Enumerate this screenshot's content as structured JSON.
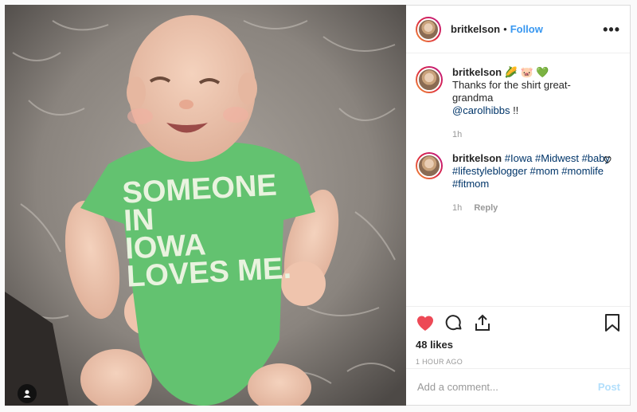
{
  "post": {
    "username": "britkelson",
    "follow_label": "Follow",
    "dot": "•",
    "more_label": "•••"
  },
  "photo": {
    "shirt_text_lines": [
      "SOMEONE",
      "IN",
      "IOWA",
      "LOVES ME."
    ]
  },
  "comments": [
    {
      "username": "britkelson",
      "emojis": "🌽 🐷 💚",
      "text_before": "Thanks for the shirt great-grandma",
      "mention": "@carolhibbs",
      "text_after": " !!",
      "time": "1h"
    },
    {
      "username": "britkelson",
      "hashtags": "#Iowa #Midwest #baby #lifestyleblogger #mom #momlife #fitmom",
      "time": "1h",
      "reply_label": "Reply"
    }
  ],
  "stats": {
    "likes": "48 likes",
    "time_ago": "1 HOUR AGO"
  },
  "add_comment": {
    "placeholder": "Add a comment...",
    "post_label": "Post"
  },
  "colors": {
    "accent": "#3897f0",
    "like_red": "#ed4956",
    "onesie_green": "#5fbf6a"
  }
}
